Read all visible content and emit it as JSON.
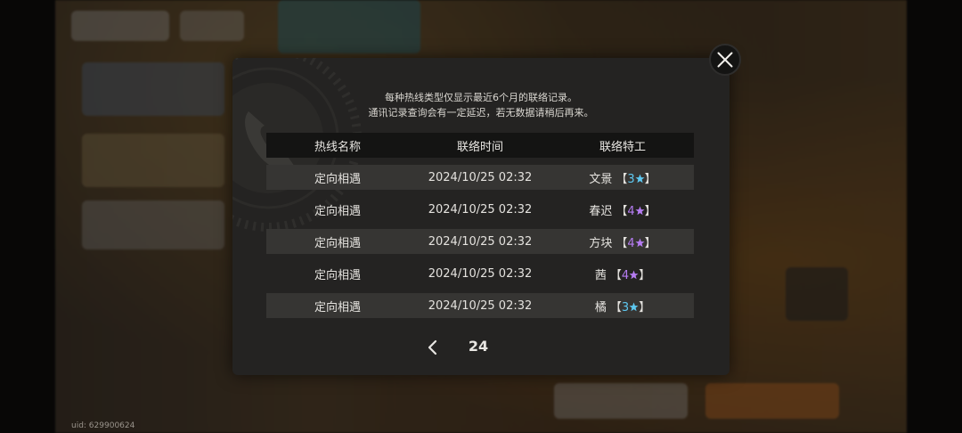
{
  "uid": "uid: 629900624",
  "notice": {
    "line1": "每种热线类型仅显示最近6个月的联络记录。",
    "line2": "通讯记录查询会有一定延迟，若无数据请稍后再来。"
  },
  "table": {
    "headers": [
      "热线名称",
      "联络时间",
      "联络特工"
    ],
    "rows": [
      {
        "hotline": "定向相遇",
        "time": "2024/10/25 02:32",
        "agent": "文景",
        "rank": "3",
        "rank_color": "#5ec8f0"
      },
      {
        "hotline": "定向相遇",
        "time": "2024/10/25 02:32",
        "agent": "春迟",
        "rank": "4",
        "rank_color": "#b57cf2"
      },
      {
        "hotline": "定向相遇",
        "time": "2024/10/25 02:32",
        "agent": "方块",
        "rank": "4",
        "rank_color": "#b57cf2"
      },
      {
        "hotline": "定向相遇",
        "time": "2024/10/25 02:32",
        "agent": "茜",
        "rank": "4",
        "rank_color": "#b57cf2"
      },
      {
        "hotline": "定向相遇",
        "time": "2024/10/25 02:32",
        "agent": "橘",
        "rank": "3",
        "rank_color": "#5ec8f0"
      }
    ]
  },
  "pager": {
    "page": "24"
  },
  "icons": {
    "close": "close-icon",
    "prev": "chevron-left-icon",
    "star": "star-icon",
    "deco": "phone-icon"
  },
  "colors": {
    "panel": "#242322",
    "header_bar": "#141413",
    "row_shade": "#363533",
    "rank3": "#5ec8f0",
    "rank4": "#b57cf2"
  }
}
